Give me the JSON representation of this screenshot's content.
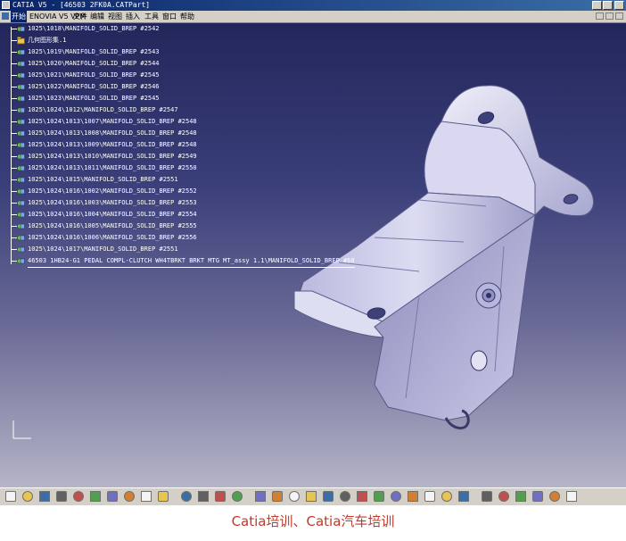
{
  "window": {
    "title": "CATIA V5 - [46503 2FK0A.CATPart]"
  },
  "menu": {
    "items": [
      "开始",
      "ENOVIA V5 VPM",
      "文件",
      "编辑",
      "视图",
      "插入",
      "工具",
      "窗口",
      "帮助"
    ]
  },
  "tree": {
    "nodes": [
      {
        "label": "1025\\1018\\MANIFOLD_SOLID_BREP #2542",
        "icon": "solid-body-icon"
      },
      {
        "label": "几何图形集.1",
        "icon": "geometrical-set-icon"
      },
      {
        "label": "1025\\1019\\MANIFOLD_SOLID_BREP #2543",
        "icon": "solid-body-icon"
      },
      {
        "label": "1025\\1020\\MANIFOLD_SOLID_BREP #2544",
        "icon": "solid-body-icon"
      },
      {
        "label": "1025\\1021\\MANIFOLD_SOLID_BREP #2545",
        "icon": "solid-body-icon"
      },
      {
        "label": "1025\\1022\\MANIFOLD_SOLID_BREP #2546",
        "icon": "solid-body-icon"
      },
      {
        "label": "1025\\1023\\MANIFOLD_SOLID_BREP #2545",
        "icon": "solid-body-icon"
      },
      {
        "label": "1025\\1024\\1012\\MANIFOLD_SOLID_BREP #2547",
        "icon": "solid-body-icon"
      },
      {
        "label": "1025\\1024\\1013\\1007\\MANIFOLD_SOLID_BREP #2548",
        "icon": "solid-body-icon"
      },
      {
        "label": "1025\\1024\\1013\\1008\\MANIFOLD_SOLID_BREP #2548",
        "icon": "solid-body-icon"
      },
      {
        "label": "1025\\1024\\1013\\1009\\MANIFOLD_SOLID_BREP #2548",
        "icon": "solid-body-icon"
      },
      {
        "label": "1025\\1024\\1013\\1010\\MANIFOLD_SOLID_BREP #2549",
        "icon": "solid-body-icon"
      },
      {
        "label": "1025\\1024\\1013\\1011\\MANIFOLD_SOLID_BREP #2550",
        "icon": "solid-body-icon"
      },
      {
        "label": "1025\\1024\\1015\\MANIFOLD_SOLID_BREP #2551",
        "icon": "solid-body-icon"
      },
      {
        "label": "1025\\1024\\1016\\1002\\MANIFOLD_SOLID_BREP #2552",
        "icon": "solid-body-icon"
      },
      {
        "label": "1025\\1024\\1016\\1003\\MANIFOLD_SOLID_BREP #2553",
        "icon": "solid-body-icon"
      },
      {
        "label": "1025\\1024\\1016\\1004\\MANIFOLD_SOLID_BREP #2554",
        "icon": "solid-body-icon"
      },
      {
        "label": "1025\\1024\\1016\\1005\\MANIFOLD_SOLID_BREP #2555",
        "icon": "solid-body-icon"
      },
      {
        "label": "1025\\1024\\1016\\1006\\MANIFOLD_SOLID_BREP #2556",
        "icon": "solid-body-icon"
      },
      {
        "label": "1025\\1024\\1017\\MANIFOLD_SOLID_BREP #2551",
        "icon": "solid-body-icon"
      },
      {
        "label": "46503 1HB24-G1 PEDAL COMPL-CLUTCH WH4TBRKT BRKT MTG MT_assy 1.1\\MANIFOLD_SOLID_BREP #68",
        "icon": "solid-body-icon",
        "selected": true
      }
    ]
  },
  "toolbar": {
    "icons": [
      "new-icon",
      "open-icon",
      "save-icon",
      "print-icon",
      "cut-icon",
      "copy-icon",
      "paste-icon",
      "undo-icon",
      "redo-icon",
      "whats-this-icon",
      "formula-icon",
      "comment-icon",
      "catalog-icon",
      "measure-icon",
      "apply-material-icon",
      "fly-mode-icon",
      "fit-all-icon",
      "pan-icon",
      "rotate-icon",
      "zoom-in-icon",
      "zoom-out-icon",
      "normal-view-icon",
      "multi-view-icon",
      "iso-view-icon",
      "shading-icon",
      "hide-show-icon",
      "swap-visible-icon",
      "sketcher-icon",
      "part-design-icon",
      "compass-icon",
      "snap-icon",
      "update-icon",
      "scale-icon"
    ]
  },
  "caption": {
    "text": "Catia培训、Catia汽车培训"
  },
  "colors": {
    "caption": "#c0392b",
    "background_top": "#22265a",
    "background_bottom": "#b5b4c8",
    "part": "#c7c6e8"
  }
}
